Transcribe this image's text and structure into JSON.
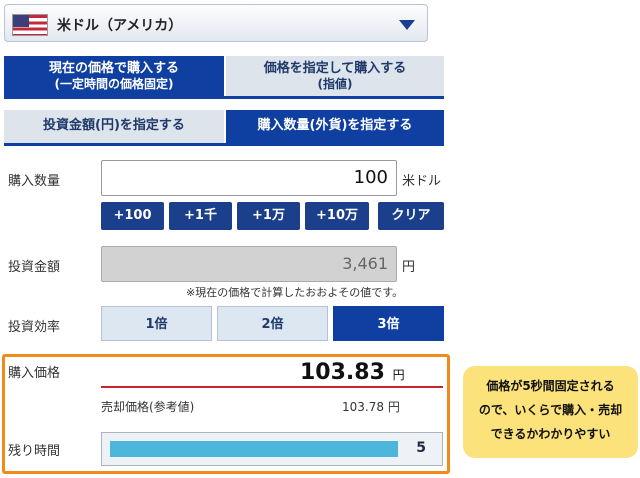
{
  "currency": {
    "flag_icon": "us-flag-icon",
    "name": "米ドル（アメリカ）",
    "dropdown_icon": "caret-down-icon"
  },
  "order_type_tabs": [
    {
      "line1": "現在の価格で購入する",
      "line2": "(一定時間の価格固定)",
      "selected": true
    },
    {
      "line1": "価格を指定して購入する",
      "line2": "(指値)",
      "selected": false
    }
  ],
  "input_mode_tabs": [
    {
      "label": "投資金額(円)を指定する",
      "selected": false
    },
    {
      "label": "購入数量(外貨)を指定する",
      "selected": true
    }
  ],
  "quantity": {
    "label": "購入数量",
    "value": "100",
    "unit": "米ドル"
  },
  "quick_buttons": [
    "+100",
    "+1千",
    "+1万",
    "+10万",
    "クリア"
  ],
  "investment": {
    "label": "投資金額",
    "value": "3,461",
    "unit": "円",
    "note": "※現在の価格で計算したおおよその値です。"
  },
  "leverage": {
    "label": "投資効率",
    "options": [
      "1倍",
      "2倍",
      "3倍"
    ],
    "selected": "3倍"
  },
  "purchase_price": {
    "label": "購入価格",
    "value": "103.83",
    "unit": "円"
  },
  "sell_price": {
    "label": "売却価格(参考値)",
    "value": "103.78",
    "unit": "円"
  },
  "remaining_time": {
    "label": "残り時間",
    "value": "5",
    "progress_fraction": 0.88
  },
  "callout": {
    "lines": [
      "価格が5秒間固定される",
      "ので、いくらで購入・売却",
      "できるかわかりやすい"
    ]
  },
  "colors": {
    "accent": "#0f3fa0",
    "highlight_frame": "#f08a1a",
    "timer_fill": "#4db6dc",
    "callout_bg": "#fbe27a",
    "price_line": "#c8222c"
  }
}
